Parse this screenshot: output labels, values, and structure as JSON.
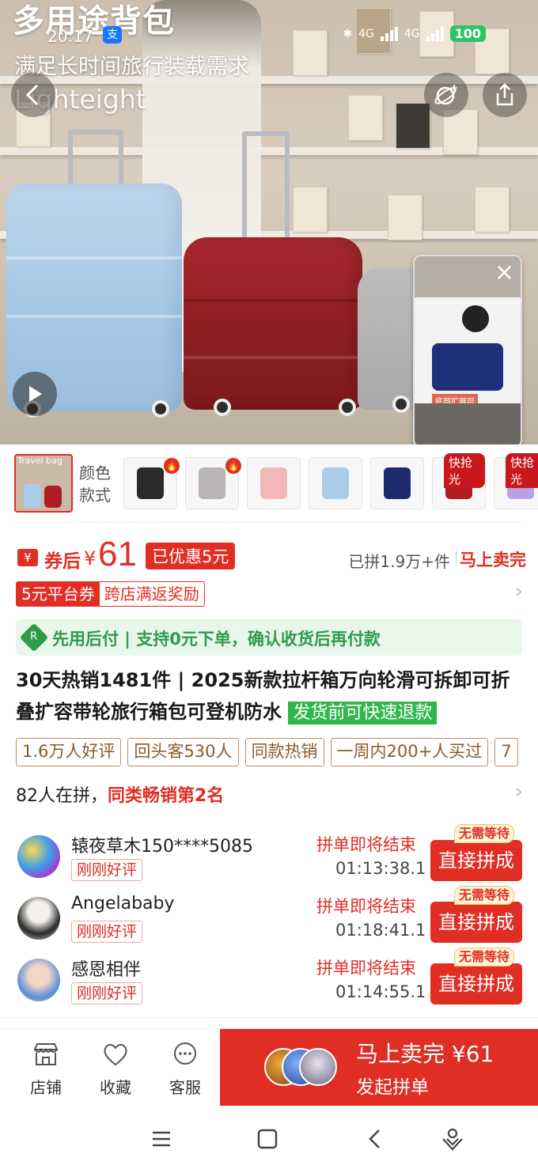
{
  "status_bar": {
    "time": "20:17",
    "alipay_icon": "支",
    "network": "4G",
    "battery": "100"
  },
  "hero": {
    "title": "多用途背包",
    "subtitle": "满足长时间旅行装载需求",
    "brand_text": "Lighteight",
    "video_label": "底部扩展层"
  },
  "variants": {
    "label": "颜色款式",
    "first_caption": "Travel bag",
    "thumbs": [
      {
        "color": "#2a2a2a",
        "badge": "hot"
      },
      {
        "color": "#b9b4b4",
        "badge": "hot"
      },
      {
        "color": "#f1b8b8",
        "badge": ""
      },
      {
        "color": "#a9cde9",
        "badge": ""
      },
      {
        "color": "#1e2a70",
        "badge": ""
      },
      {
        "color": "#b01c24",
        "badge": "快抢光"
      },
      {
        "color": "#b9a2e2",
        "badge": "快抢光"
      }
    ]
  },
  "price": {
    "coupon_icon": "¥",
    "after_label": "券后",
    "currency": "¥",
    "amount": "61",
    "saved": "已优惠5元",
    "sold_count": "已拼1.9万+件",
    "sold_out": "马上卖完"
  },
  "coupon": {
    "left": "5元平台券",
    "right": "跨店满返奖励"
  },
  "pay_later": {
    "icon": "R",
    "text": "先用后付 | 支持0元下单，确认收货后再付款"
  },
  "product": {
    "title": "30天热销1481件 | 2025新款拉杆箱万向轮滑可拆卸可折叠扩容带轮旅行箱包可登机防水",
    "refund_tag": "发货前可快速退款"
  },
  "tags": [
    "1.6万人好评",
    "回头客530人",
    "同款热销",
    "一周内200+人买过",
    "7"
  ],
  "group": {
    "count_text": "82人在拼，",
    "rank_text": "同类畅销第2名",
    "items": [
      {
        "name": "辕夜草木150****5085",
        "tag": "刚刚好评",
        "ending": "拼单即将结束",
        "time": "01:13:38.1",
        "badge": "无需等待",
        "button": "直接拼成"
      },
      {
        "name": "Angelababy",
        "tag": "刚刚好评",
        "ending": "拼单即将结束",
        "time": "01:18:41.1",
        "badge": "无需等待",
        "button": "直接拼成"
      },
      {
        "name": "感恩相伴",
        "tag": "刚刚好评",
        "ending": "拼单即将结束",
        "time": "01:14:55.1",
        "badge": "无需等待",
        "button": "直接拼成"
      }
    ]
  },
  "bottom": {
    "store": "店铺",
    "favorite": "收藏",
    "service": "客服",
    "buy_line1": "马上卖完 ¥61",
    "buy_line2": "发起拼单"
  },
  "colors": {
    "accent": "#e02e24",
    "green": "#2e9b4c"
  }
}
